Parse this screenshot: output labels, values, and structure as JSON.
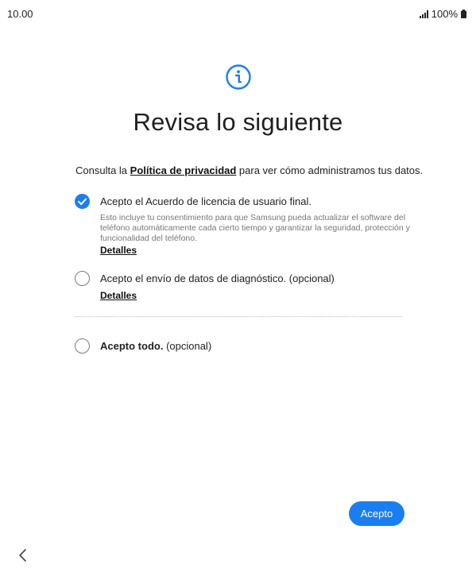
{
  "status_bar": {
    "time": "10.00",
    "battery": "100%",
    "signal_icon": "signal-icon",
    "battery_icon": "battery-icon"
  },
  "header": {
    "icon": "info-icon",
    "accent_color": "#1a7ef0",
    "title": "Revisa lo siguiente"
  },
  "intro": {
    "prefix": "Consulta la ",
    "link": "Política de privacidad",
    "suffix": " para ver cómo administramos tus datos."
  },
  "options": [
    {
      "checked": true,
      "label": "Acepto el Acuerdo de licencia de usuario final.",
      "description": "Esto incluye tu consentimiento para que Samsung pueda actualizar el software del teléfono automáticamente cada cierto tiempo y garantizar la seguridad, protección y funcionalidad del teléfono.",
      "details": "Detalles"
    },
    {
      "checked": false,
      "label": "Acepto el envío de datos de diagnóstico.",
      "optional": "(opcional)",
      "details": "Detalles"
    },
    {
      "checked": false,
      "label": "Acepto todo.",
      "optional": "(opcional)"
    }
  ],
  "footer": {
    "accept_label": "Acepto",
    "back_icon": "chevron-left-icon"
  }
}
